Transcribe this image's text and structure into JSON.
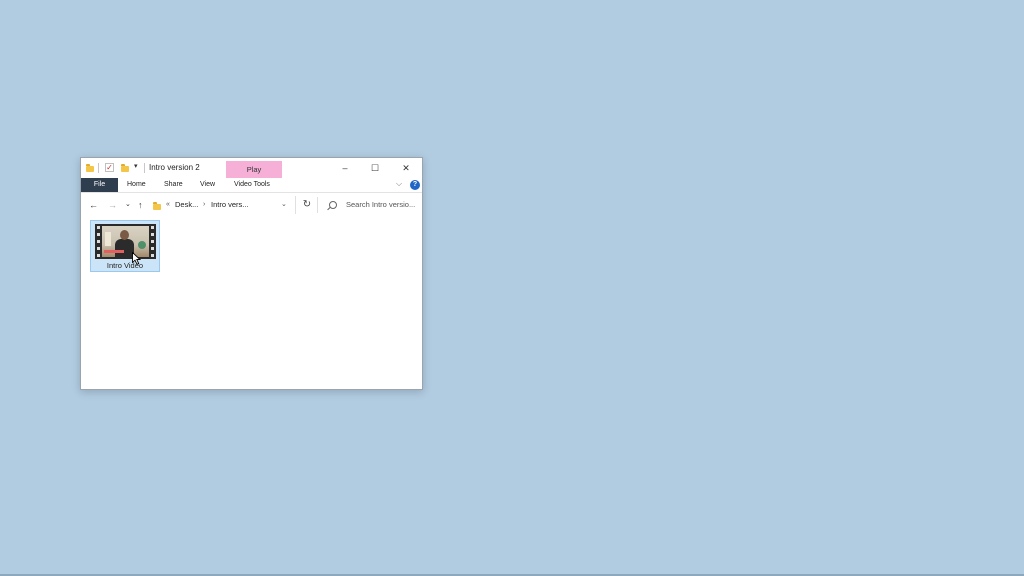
{
  "window": {
    "title": "Intro version 2",
    "context_tab": "Play",
    "controls": {
      "minimize": "–",
      "maximize": "☐",
      "close": "✕"
    }
  },
  "ribbon": {
    "tabs": [
      "File",
      "Home",
      "Share",
      "View",
      "Video Tools"
    ],
    "help": "?"
  },
  "address": {
    "overflow": "«",
    "segments": [
      "Desk...",
      "Intro vers..."
    ]
  },
  "search": {
    "placeholder": "Search Intro versio..."
  },
  "files": [
    {
      "name": "Intro Video",
      "type": "video",
      "selected": true
    }
  ],
  "colors": {
    "desktop": "#b1cbe1",
    "file_tab": "#2f3e4e",
    "play_tab": "#f6b0d8",
    "selection": "#cce4f7",
    "help": "#1f66c7"
  },
  "icons": [
    "folder-icon",
    "checkmark-icon",
    "back-arrow-icon",
    "forward-arrow-icon",
    "up-arrow-icon",
    "refresh-icon",
    "search-icon",
    "help-icon"
  ]
}
